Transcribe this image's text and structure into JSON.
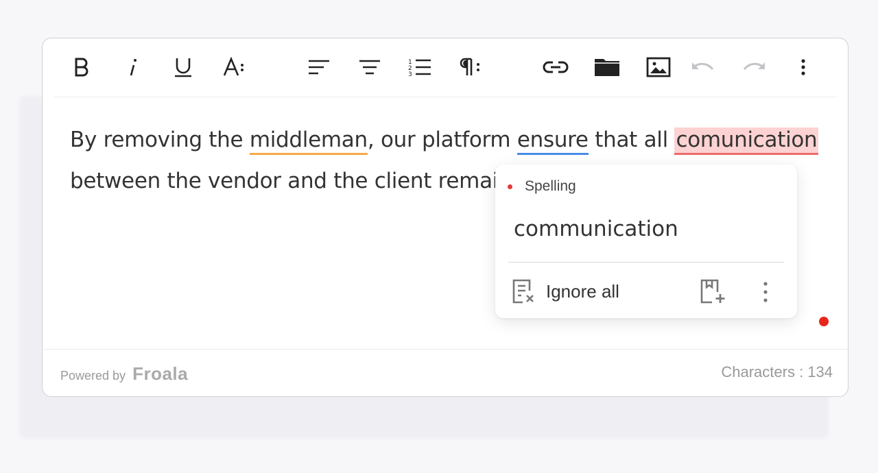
{
  "content": {
    "line1": {
      "before": "By removing the ",
      "w1": "middleman",
      "mid1": ", our platform ",
      "w2": "ensure",
      "mid2": " that all ",
      "w3": "comunication"
    },
    "line2": "between the vendor and the client remain"
  },
  "popup": {
    "category": "Spelling",
    "suggestion": "communication",
    "ignore_label": "Ignore all"
  },
  "footer": {
    "powered_by": "Powered by",
    "brand": "Froala",
    "char_count": "Characters : 134"
  },
  "colors": {
    "grammar_underline": "#f5a947",
    "style_underline": "#4a8ae8",
    "spelling_underline": "#ee6b6b",
    "spelling_highlight": "#fdd2d2",
    "status_dot": "#e8261c"
  },
  "toolbar_icons": [
    "bold-icon",
    "italic-icon",
    "underline-icon",
    "font-size-icon",
    "align-left-icon",
    "align-center-icon",
    "ordered-list-icon",
    "paragraph-format-icon",
    "link-icon",
    "folder-icon",
    "image-icon",
    "undo-icon",
    "redo-icon",
    "more-vertical-icon"
  ]
}
